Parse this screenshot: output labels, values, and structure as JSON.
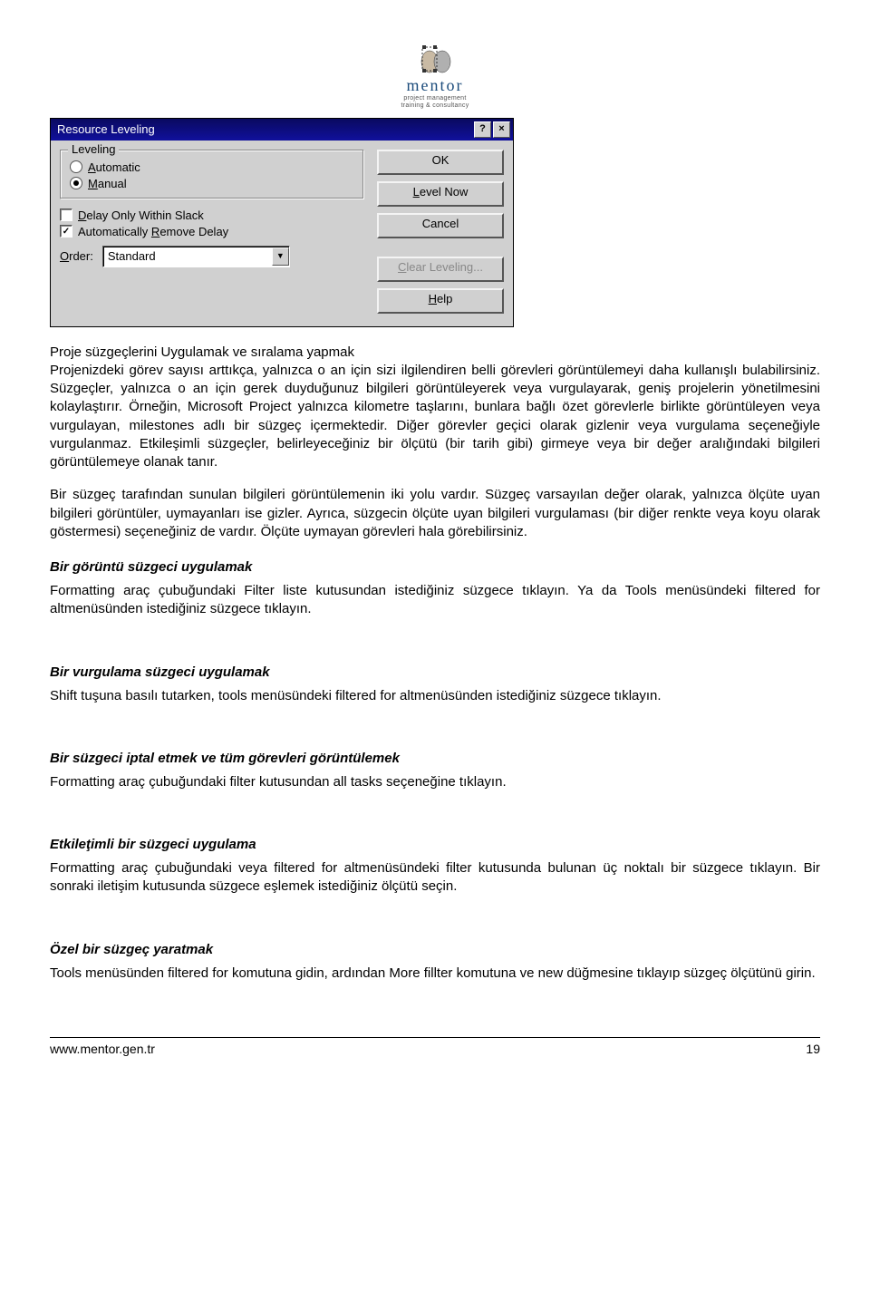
{
  "logo": {
    "name": "mentor",
    "tag1": "project management",
    "tag2": "training & consultancy"
  },
  "dialog": {
    "title": "Resource Leveling",
    "legend": "Leveling",
    "radio_auto_long": "utomatic",
    "radio_manual_long": "anual",
    "check_delay_long": "elay Only Within Slack",
    "check_remove": "Automatically ",
    "check_remove_long": "emove Delay",
    "order_label_long": "rder:",
    "order_value": "Standard",
    "btn_ok": "OK",
    "btn_level_long": "evel Now",
    "btn_cancel": "Cancel",
    "btn_clear_long": "lear Leveling...",
    "btn_help_long": "elp"
  },
  "doc": {
    "h1": "Proje süzgeçlerini Uygulamak ve sıralama yapmak",
    "p1": "Projenizdeki görev sayısı arttıkça, yalnızca o an için sizi ilgilendiren belli görevleri görüntülemeyi daha kullanışlı bulabilirsiniz. Süzgeçler, yalnızca o an için gerek duyduğunuz bilgileri görüntüleyerek veya vurgulayarak, geniş projelerin yönetilmesini kolaylaştırır. Örneğin, Microsoft Project yalnızca kilometre taşlarını, bunlara bağlı özet görevlerle birlikte görüntüleyen veya vurgulayan, milestones adlı bir süzgeç içermektedir. Diğer görevler geçici olarak gizlenir veya vurgulama seçeneğiyle vurgulanmaz. Etkileşimli süzgeçler, belirleyeceğiniz bir ölçütü (bir tarih gibi) girmeye veya bir değer aralığındaki bilgileri görüntülemeye olanak tanır.",
    "p2": "Bir süzgeç tarafından sunulan bilgileri görüntülemenin iki yolu vardır. Süzgeç varsayılan değer olarak, yalnızca ölçüte uyan bilgileri görüntüler, uymayanları ise gizler. Ayrıca, süzgecin ölçüte uyan bilgileri vurgulaması (bir diğer renkte veya koyu olarak göstermesi) seçeneğiniz de vardır. Ölçüte uymayan görevleri hala görebilirsiniz.",
    "h2": "Bir görüntü süzgeci uygulamak",
    "p3": "Formatting araç çubuğundaki Filter liste kutusundan istediğiniz süzgece tıklayın. Ya da Tools menüsündeki filtered for altmenüsünden istediğiniz süzgece tıklayın.",
    "h3": "Bir vurgulama süzgeci uygulamak",
    "p4": "Shift tuşuna basılı tutarken, tools menüsündeki filtered for altmenüsünden istediğiniz süzgece tıklayın.",
    "h4": "Bir süzgeci iptal etmek ve  tüm görevleri görüntülemek",
    "p5": "Formatting araç çubuğundaki filter kutusundan all tasks seçeneğine tıklayın.",
    "h5": "Etkileţimli bir süzgeci uygulama",
    "p6": "Formatting  araç çubuğundaki veya filtered for altmenüsündeki filter kutusunda bulunan üç noktalı bir süzgece tıklayın. Bir sonraki iletişim kutusunda süzgece eşlemek istediğiniz ölçütü seçin.",
    "h6": "Özel bir süzgeç yaratmak",
    "p7": "Tools menüsünden filtered for komutuna gidin, ardından More fillter komutuna ve new düğmesine tıklayıp süzgeç ölçütünü girin."
  },
  "footer": {
    "left": "www.mentor.gen.tr",
    "right": "19"
  }
}
